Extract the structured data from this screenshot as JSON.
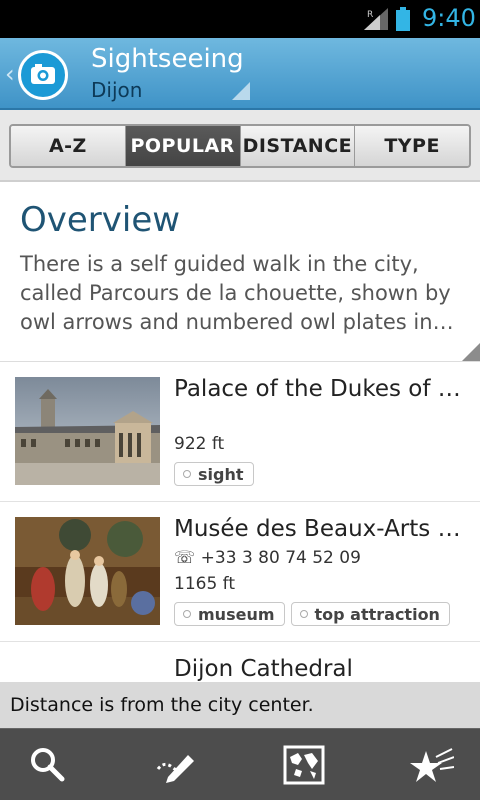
{
  "status_bar": {
    "time": "9:40",
    "roaming": "R"
  },
  "header": {
    "title": "Sightseeing",
    "subtitle": "Dijon",
    "back": "‹",
    "logo_icon": "camera-icon"
  },
  "tabs": [
    {
      "label": "A-Z",
      "active": false
    },
    {
      "label": "POPULAR",
      "active": true
    },
    {
      "label": "DISTANCE",
      "active": false
    },
    {
      "label": "TYPE",
      "active": false
    }
  ],
  "overview": {
    "title": "Overview",
    "text": "There is a self guided walk in the city, called Parcours de la chouette, shown by owl arrows and numbered owl plates in…"
  },
  "list": [
    {
      "title": "Palace of the Dukes of B…",
      "phone": "",
      "distance": "922 ft",
      "tags": [
        "sight"
      ]
    },
    {
      "title": "Musée des Beaux-Arts d…",
      "phone": "☏ +33 3 80 74 52 09",
      "distance": "1165 ft",
      "tags": [
        "museum",
        "top attraction"
      ]
    },
    {
      "title": "Dijon Cathedral",
      "phone": "",
      "distance": "",
      "tags": []
    }
  ],
  "info_bar": "Distance is from the city center.",
  "bottom_bar": {
    "icons": [
      "search-icon",
      "edit-path-icon",
      "map-icon",
      "favorites-icon"
    ]
  },
  "colors": {
    "accent": "#33b5e5",
    "header": "#4fa3d3",
    "title": "#1f5474"
  }
}
